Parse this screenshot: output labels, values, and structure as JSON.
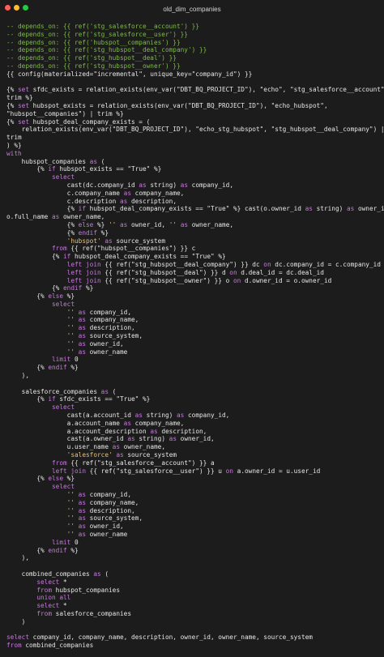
{
  "window": {
    "title": "old_dim_companies",
    "traffic_lights": {
      "close": "#ff5f57",
      "minimize": "#febc2e",
      "maximize": "#28c840"
    }
  },
  "colors": {
    "comment": "#7dbb4a",
    "keyword": "#c678dd",
    "string": "#e6c07b",
    "text": "#e6e6e6"
  },
  "code_lines": [
    [
      [
        "cm",
        "-- depends_on: {{ ref('stg_salesforce__account') }}"
      ]
    ],
    [
      [
        "cm",
        "-- depends_on: {{ ref('stg_salesforce__user') }}"
      ]
    ],
    [
      [
        "cm",
        "-- depends_on: {{ ref('hubspot__companies') }}"
      ]
    ],
    [
      [
        "cm",
        "-- depends_on: {{ ref('stg_hubspot__deal_company') }}"
      ]
    ],
    [
      [
        "cm",
        "-- depends_on: {{ ref('stg_hubspot__deal') }}"
      ]
    ],
    [
      [
        "cm",
        "-- depends_on: {{ ref('stg_hubspot__owner') }}"
      ]
    ],
    [
      [
        "tx",
        "{{ config(materialized=\"incremental\", unique_key=\"company_id\") }}"
      ]
    ],
    [
      [
        "tx",
        ""
      ]
    ],
    [
      [
        "tx",
        "{% "
      ],
      [
        "kw",
        "set"
      ],
      [
        "tx",
        " sfdc_exists = relation_exists(env_var(\"DBT_BQ_PROJECT_ID\"), \"echo\", \"stg_salesforce__account\") |"
      ]
    ],
    [
      [
        "tx",
        "trim %}"
      ]
    ],
    [
      [
        "tx",
        "{% "
      ],
      [
        "kw",
        "set"
      ],
      [
        "tx",
        " hubspot_exists = relation_exists(env_var(\"DBT_BQ_PROJECT_ID\"), \"echo_hubspot\","
      ]
    ],
    [
      [
        "tx",
        "\"hubspot__companies\") | trim %}"
      ]
    ],
    [
      [
        "tx",
        "{% "
      ],
      [
        "kw",
        "set"
      ],
      [
        "tx",
        " hubspot_deal_company_exists = ("
      ]
    ],
    [
      [
        "tx",
        "    relation_exists(env_var(\"DBT_BQ_PROJECT_ID\"), \"echo_stg_hubspot\", \"stg_hubspot__deal_company\") |"
      ]
    ],
    [
      [
        "tx",
        "trim"
      ]
    ],
    [
      [
        "tx",
        ") %}"
      ]
    ],
    [
      [
        "kw",
        "with"
      ]
    ],
    [
      [
        "tx",
        "    hubspot_companies "
      ],
      [
        "kw",
        "as"
      ],
      [
        "tx",
        " ("
      ]
    ],
    [
      [
        "tx",
        "        {% "
      ],
      [
        "kw",
        "if"
      ],
      [
        "tx",
        " hubspot_exists == \"True\" %}"
      ]
    ],
    [
      [
        "tx",
        "            "
      ],
      [
        "kw",
        "select"
      ]
    ],
    [
      [
        "tx",
        "                cast(dc.company_id "
      ],
      [
        "kw",
        "as"
      ],
      [
        "tx",
        " string) "
      ],
      [
        "kw",
        "as"
      ],
      [
        "tx",
        " company_id,"
      ]
    ],
    [
      [
        "tx",
        "                c.company_name "
      ],
      [
        "kw",
        "as"
      ],
      [
        "tx",
        " company_name,"
      ]
    ],
    [
      [
        "tx",
        "                c.description "
      ],
      [
        "kw",
        "as"
      ],
      [
        "tx",
        " description,"
      ]
    ],
    [
      [
        "tx",
        "                {% "
      ],
      [
        "kw",
        "if"
      ],
      [
        "tx",
        " hubspot_deal_company_exists == \"True\" %} cast(o.owner_id "
      ],
      [
        "kw",
        "as"
      ],
      [
        "tx",
        " string) "
      ],
      [
        "kw",
        "as"
      ],
      [
        "tx",
        " owner_id,"
      ]
    ],
    [
      [
        "tx",
        "o.full_name "
      ],
      [
        "kw",
        "as"
      ],
      [
        "tx",
        " owner_name,"
      ]
    ],
    [
      [
        "tx",
        "                {% "
      ],
      [
        "kw",
        "else"
      ],
      [
        "tx",
        " %} "
      ],
      [
        "str",
        "''"
      ],
      [
        "tx",
        " "
      ],
      [
        "kw",
        "as"
      ],
      [
        "tx",
        " owner_id, "
      ],
      [
        "str",
        "''"
      ],
      [
        "tx",
        " "
      ],
      [
        "kw",
        "as"
      ],
      [
        "tx",
        " owner_name,"
      ]
    ],
    [
      [
        "tx",
        "                {% "
      ],
      [
        "kw",
        "endif"
      ],
      [
        "tx",
        " %}"
      ]
    ],
    [
      [
        "tx",
        "                "
      ],
      [
        "str",
        "'hubspot'"
      ],
      [
        "tx",
        " "
      ],
      [
        "kw",
        "as"
      ],
      [
        "tx",
        " source_system"
      ]
    ],
    [
      [
        "tx",
        "            "
      ],
      [
        "kw",
        "from"
      ],
      [
        "tx",
        " {{ ref(\"hubspot__companies\") }} c"
      ]
    ],
    [
      [
        "tx",
        "            {% "
      ],
      [
        "kw",
        "if"
      ],
      [
        "tx",
        " hubspot_deal_company_exists == \"True\" %}"
      ]
    ],
    [
      [
        "tx",
        "                "
      ],
      [
        "kw",
        "left join"
      ],
      [
        "tx",
        " {{ ref(\"stg_hubspot__deal_company\") }} dc "
      ],
      [
        "kw",
        "on"
      ],
      [
        "tx",
        " dc.company_id = c.company_id"
      ]
    ],
    [
      [
        "tx",
        "                "
      ],
      [
        "kw",
        "left join"
      ],
      [
        "tx",
        " {{ ref(\"stg_hubspot__deal\") }} d "
      ],
      [
        "kw",
        "on"
      ],
      [
        "tx",
        " d.deal_id = dc.deal_id"
      ]
    ],
    [
      [
        "tx",
        "                "
      ],
      [
        "kw",
        "left join"
      ],
      [
        "tx",
        " {{ ref(\"stg_hubspot__owner\") }} o "
      ],
      [
        "kw",
        "on"
      ],
      [
        "tx",
        " d.owner_id = o.owner_id"
      ]
    ],
    [
      [
        "tx",
        "            {% "
      ],
      [
        "kw",
        "endif"
      ],
      [
        "tx",
        " %}"
      ]
    ],
    [
      [
        "tx",
        "        {% "
      ],
      [
        "kw",
        "else"
      ],
      [
        "tx",
        " %}"
      ]
    ],
    [
      [
        "tx",
        "            "
      ],
      [
        "kw",
        "select"
      ]
    ],
    [
      [
        "tx",
        "                "
      ],
      [
        "str",
        "''"
      ],
      [
        "tx",
        " "
      ],
      [
        "kw",
        "as"
      ],
      [
        "tx",
        " company_id,"
      ]
    ],
    [
      [
        "tx",
        "                "
      ],
      [
        "str",
        "''"
      ],
      [
        "tx",
        " "
      ],
      [
        "kw",
        "as"
      ],
      [
        "tx",
        " company_name,"
      ]
    ],
    [
      [
        "tx",
        "                "
      ],
      [
        "str",
        "''"
      ],
      [
        "tx",
        " "
      ],
      [
        "kw",
        "as"
      ],
      [
        "tx",
        " description,"
      ]
    ],
    [
      [
        "tx",
        "                "
      ],
      [
        "str",
        "''"
      ],
      [
        "tx",
        " "
      ],
      [
        "kw",
        "as"
      ],
      [
        "tx",
        " source_system,"
      ]
    ],
    [
      [
        "tx",
        "                "
      ],
      [
        "str",
        "''"
      ],
      [
        "tx",
        " "
      ],
      [
        "kw",
        "as"
      ],
      [
        "tx",
        " owner_id,"
      ]
    ],
    [
      [
        "tx",
        "                "
      ],
      [
        "str",
        "''"
      ],
      [
        "tx",
        " "
      ],
      [
        "kw",
        "as"
      ],
      [
        "tx",
        " owner_name"
      ]
    ],
    [
      [
        "tx",
        "            "
      ],
      [
        "kw",
        "limit"
      ],
      [
        "tx",
        " 0"
      ]
    ],
    [
      [
        "tx",
        "        {% "
      ],
      [
        "kw",
        "endif"
      ],
      [
        "tx",
        " %}"
      ]
    ],
    [
      [
        "tx",
        "    ),"
      ]
    ],
    [
      [
        "tx",
        ""
      ]
    ],
    [
      [
        "tx",
        "    salesforce_companies "
      ],
      [
        "kw",
        "as"
      ],
      [
        "tx",
        " ("
      ]
    ],
    [
      [
        "tx",
        "        {% "
      ],
      [
        "kw",
        "if"
      ],
      [
        "tx",
        " sfdc_exists == \"True\" %}"
      ]
    ],
    [
      [
        "tx",
        "            "
      ],
      [
        "kw",
        "select"
      ]
    ],
    [
      [
        "tx",
        "                cast(a.account_id "
      ],
      [
        "kw",
        "as"
      ],
      [
        "tx",
        " string) "
      ],
      [
        "kw",
        "as"
      ],
      [
        "tx",
        " company_id,"
      ]
    ],
    [
      [
        "tx",
        "                a.account_name "
      ],
      [
        "kw",
        "as"
      ],
      [
        "tx",
        " company_name,"
      ]
    ],
    [
      [
        "tx",
        "                a.account_description "
      ],
      [
        "kw",
        "as"
      ],
      [
        "tx",
        " description,"
      ]
    ],
    [
      [
        "tx",
        "                cast(a.owner_id "
      ],
      [
        "kw",
        "as"
      ],
      [
        "tx",
        " string) "
      ],
      [
        "kw",
        "as"
      ],
      [
        "tx",
        " owner_id,"
      ]
    ],
    [
      [
        "tx",
        "                u.user_name "
      ],
      [
        "kw",
        "as"
      ],
      [
        "tx",
        " owner_name,"
      ]
    ],
    [
      [
        "tx",
        "                "
      ],
      [
        "str",
        "'salesforce'"
      ],
      [
        "tx",
        " "
      ],
      [
        "kw",
        "as"
      ],
      [
        "tx",
        " source_system"
      ]
    ],
    [
      [
        "tx",
        "            "
      ],
      [
        "kw",
        "from"
      ],
      [
        "tx",
        " {{ ref(\"stg_salesforce__account\") }} a"
      ]
    ],
    [
      [
        "tx",
        "            "
      ],
      [
        "kw",
        "left join"
      ],
      [
        "tx",
        " {{ ref(\"stg_salesforce__user\") }} u "
      ],
      [
        "kw",
        "on"
      ],
      [
        "tx",
        " a.owner_id = u.user_id"
      ]
    ],
    [
      [
        "tx",
        "        {% "
      ],
      [
        "kw",
        "else"
      ],
      [
        "tx",
        " %}"
      ]
    ],
    [
      [
        "tx",
        "            "
      ],
      [
        "kw",
        "select"
      ]
    ],
    [
      [
        "tx",
        "                "
      ],
      [
        "str",
        "''"
      ],
      [
        "tx",
        " "
      ],
      [
        "kw",
        "as"
      ],
      [
        "tx",
        " company_id,"
      ]
    ],
    [
      [
        "tx",
        "                "
      ],
      [
        "str",
        "''"
      ],
      [
        "tx",
        " "
      ],
      [
        "kw",
        "as"
      ],
      [
        "tx",
        " company_name,"
      ]
    ],
    [
      [
        "tx",
        "                "
      ],
      [
        "str",
        "''"
      ],
      [
        "tx",
        " "
      ],
      [
        "kw",
        "as"
      ],
      [
        "tx",
        " description,"
      ]
    ],
    [
      [
        "tx",
        "                "
      ],
      [
        "str",
        "''"
      ],
      [
        "tx",
        " "
      ],
      [
        "kw",
        "as"
      ],
      [
        "tx",
        " source_system,"
      ]
    ],
    [
      [
        "tx",
        "                "
      ],
      [
        "str",
        "''"
      ],
      [
        "tx",
        " "
      ],
      [
        "kw",
        "as"
      ],
      [
        "tx",
        " owner_id,"
      ]
    ],
    [
      [
        "tx",
        "                "
      ],
      [
        "str",
        "''"
      ],
      [
        "tx",
        " "
      ],
      [
        "kw",
        "as"
      ],
      [
        "tx",
        " owner_name"
      ]
    ],
    [
      [
        "tx",
        "            "
      ],
      [
        "kw",
        "limit"
      ],
      [
        "tx",
        " 0"
      ]
    ],
    [
      [
        "tx",
        "        {% "
      ],
      [
        "kw",
        "endif"
      ],
      [
        "tx",
        " %}"
      ]
    ],
    [
      [
        "tx",
        "    ),"
      ]
    ],
    [
      [
        "tx",
        ""
      ]
    ],
    [
      [
        "tx",
        "    combined_companies "
      ],
      [
        "kw",
        "as"
      ],
      [
        "tx",
        " ("
      ]
    ],
    [
      [
        "tx",
        "        "
      ],
      [
        "kw",
        "select"
      ],
      [
        "tx",
        " *"
      ]
    ],
    [
      [
        "tx",
        "        "
      ],
      [
        "kw",
        "from"
      ],
      [
        "tx",
        " hubspot_companies"
      ]
    ],
    [
      [
        "tx",
        "        "
      ],
      [
        "kw",
        "union all"
      ]
    ],
    [
      [
        "tx",
        "        "
      ],
      [
        "kw",
        "select"
      ],
      [
        "tx",
        " *"
      ]
    ],
    [
      [
        "tx",
        "        "
      ],
      [
        "kw",
        "from"
      ],
      [
        "tx",
        " salesforce_companies"
      ]
    ],
    [
      [
        "tx",
        "    )"
      ]
    ],
    [
      [
        "tx",
        ""
      ]
    ],
    [
      [
        "kw",
        "select"
      ],
      [
        "tx",
        " company_id, company_name, description, owner_id, owner_name, source_system"
      ]
    ],
    [
      [
        "kw",
        "from"
      ],
      [
        "tx",
        " combined_companies"
      ]
    ]
  ]
}
